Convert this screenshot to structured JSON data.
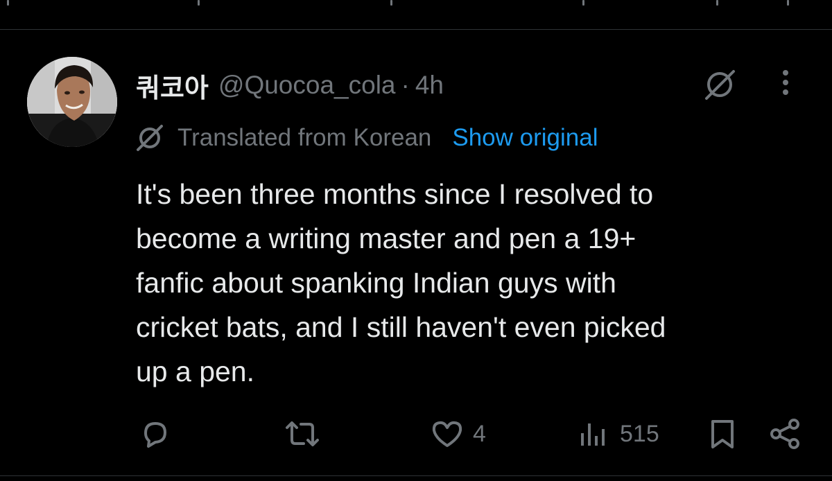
{
  "tweet": {
    "display_name": "쿼코아",
    "handle": "@Quocoa_cola",
    "separator": "·",
    "time": "4h",
    "translation": {
      "label": "Translated from Korean",
      "show_original": "Show original"
    },
    "text_lines": [
      "It's been three months since I resolved to",
      "become a writing master and pen a 19+",
      "fanfic about spanking Indian guys with",
      "cricket bats, and I still haven't even picked",
      "up a pen."
    ],
    "actions": {
      "reply_icon": "reply-icon",
      "retweet_icon": "retweet-icon",
      "like_icon": "like-icon",
      "like_count": "4",
      "views_icon": "views-icon",
      "view_count": "515",
      "bookmark_icon": "bookmark-icon",
      "share_icon": "share-icon"
    },
    "header_icons": [
      "grok-icon",
      "more-icon"
    ]
  },
  "colors": {
    "background": "#000000",
    "text_primary": "#e7e9ea",
    "text_secondary": "#71767b",
    "link": "#1d9bf0",
    "divider": "#2f3336"
  }
}
